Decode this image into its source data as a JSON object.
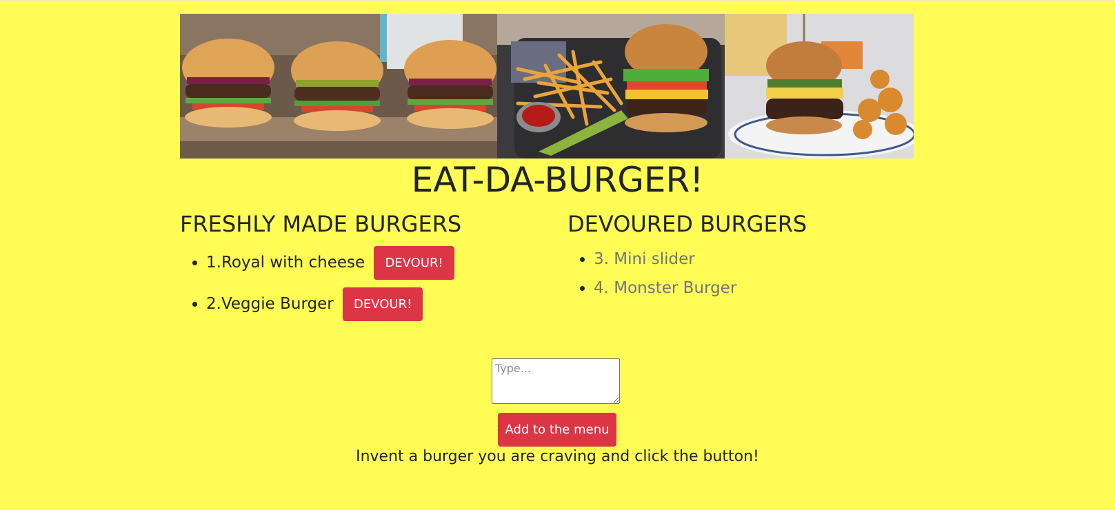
{
  "page": {
    "title": "EAT-DA-BURGER!",
    "background": "#fffc55"
  },
  "hero": {
    "images": [
      "burger-trio-photo",
      "burger-fries-photo",
      "burger-waffle-fries-photo"
    ]
  },
  "fresh": {
    "heading": "FRESHLY MADE BURGERS",
    "items": [
      {
        "label": "1.Royal with cheese",
        "button": "DEVOUR!"
      },
      {
        "label": "2.Veggie Burger",
        "button": "DEVOUR!"
      }
    ]
  },
  "devoured": {
    "heading": "DEVOURED BURGERS",
    "items": [
      {
        "label": "3. Mini slider"
      },
      {
        "label": "4. Monster Burger"
      }
    ]
  },
  "form": {
    "placeholder": "Type...",
    "value": "",
    "submit_label": "Add to the menu",
    "hint": "Invent a burger you are craving and click the button!"
  },
  "colors": {
    "accent": "#dc3545",
    "muted": "#6c757d",
    "text": "#212529"
  }
}
